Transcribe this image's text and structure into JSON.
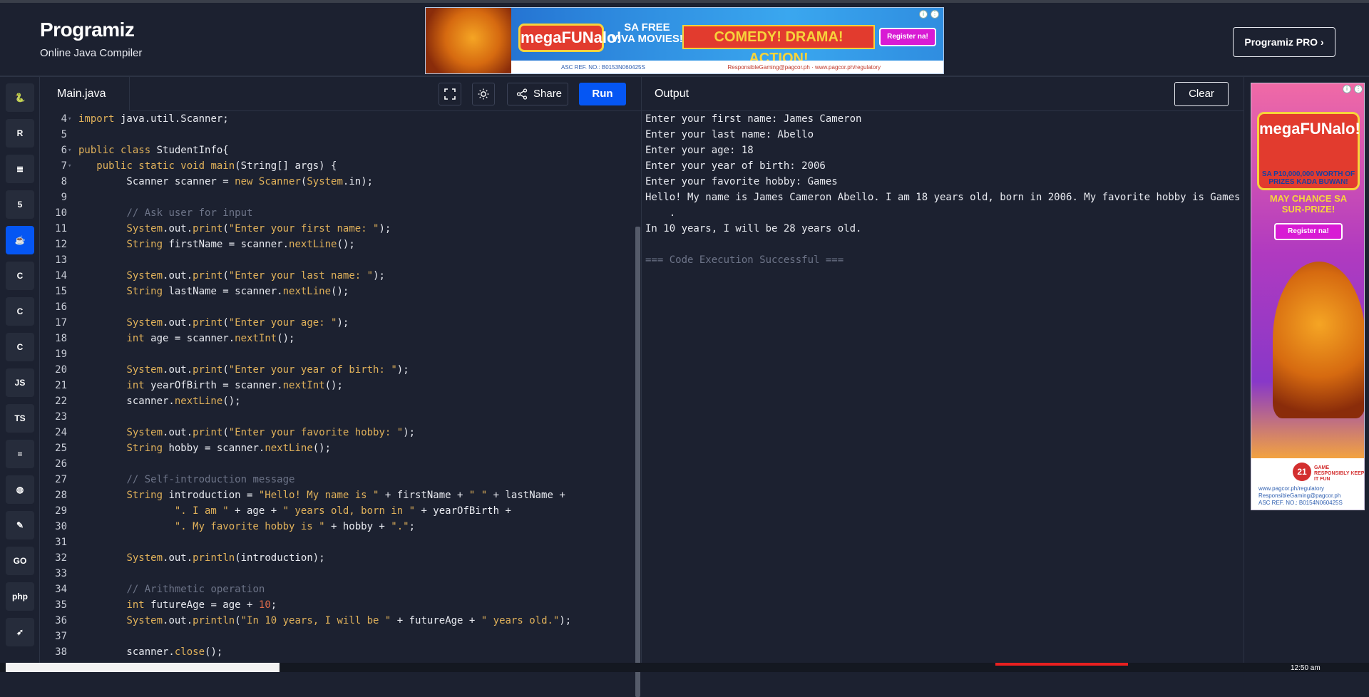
{
  "header": {
    "logo": "Programiz",
    "subtitle": "Online Java Compiler",
    "pro_button": "Programiz PRO ›"
  },
  "ad_top": {
    "mega": "megaFUNalo!",
    "free_line1": "SA FREE",
    "free_line2": "VIVA MOVIES!",
    "headline": "COMEDY! DRAMA! ACTION!",
    "register": "Register na!",
    "asc": "ASC REF. NO.: B0153N060425S",
    "responsible": "ResponsibleGaming@pagcor.ph · www.pagcor.ph/regulatory"
  },
  "sidebar": {
    "items": [
      {
        "name": "python",
        "icon": "python-icon",
        "label": "🐍"
      },
      {
        "name": "r",
        "icon": "r-icon",
        "label": "R"
      },
      {
        "name": "sql",
        "icon": "database-icon",
        "label": "≣"
      },
      {
        "name": "html",
        "icon": "html5-icon",
        "label": "5"
      },
      {
        "name": "java",
        "icon": "java-icon",
        "label": "☕"
      },
      {
        "name": "c",
        "icon": "c-icon",
        "label": "C"
      },
      {
        "name": "cpp",
        "icon": "cpp-icon",
        "label": "C"
      },
      {
        "name": "csharp",
        "icon": "csharp-icon",
        "label": "C"
      },
      {
        "name": "js",
        "icon": "js-icon",
        "label": "JS"
      },
      {
        "name": "ts",
        "icon": "ts-icon",
        "label": "TS"
      },
      {
        "name": "go",
        "icon": "stack-icon",
        "label": "≡"
      },
      {
        "name": "ruby",
        "icon": "ball-icon",
        "label": "◍"
      },
      {
        "name": "draw",
        "icon": "pen-icon",
        "label": "✎"
      },
      {
        "name": "golang",
        "icon": "go-icon",
        "label": "GO"
      },
      {
        "name": "php",
        "icon": "php-icon",
        "label": "php"
      },
      {
        "name": "swift",
        "icon": "swift-icon",
        "label": "➶"
      }
    ]
  },
  "editor": {
    "tab": "Main.java",
    "share": "Share",
    "run": "Run",
    "lines": [
      {
        "n": "4",
        "fold": "▾",
        "html": "<span class=\"kw\">import</span> java.util.Scanner;"
      },
      {
        "n": "5",
        "fold": "",
        "html": ""
      },
      {
        "n": "6",
        "fold": "▾",
        "html": "<span class=\"kw\">public class</span> StudentInfo{"
      },
      {
        "n": "7",
        "fold": "▾",
        "html": "   <span class=\"kw\">public static void</span> <span class=\"fn\">main</span>(String[] args) {"
      },
      {
        "n": "8",
        "fold": "",
        "html": "        Scanner scanner = <span class=\"kw\">new</span> <span class=\"fn\">Scanner</span>(<span class=\"ty\">System</span>.in);"
      },
      {
        "n": "9",
        "fold": "",
        "html": ""
      },
      {
        "n": "10",
        "fold": "",
        "html": "        <span class=\"cm\">// Ask user for input</span>"
      },
      {
        "n": "11",
        "fold": "",
        "html": "        <span class=\"ty\">System</span>.out.<span class=\"fn\">print</span>(<span class=\"st\">\"Enter your first name: \"</span>);"
      },
      {
        "n": "12",
        "fold": "",
        "html": "        <span class=\"ty\">String</span> firstName = scanner.<span class=\"fn\">nextLine</span>();"
      },
      {
        "n": "13",
        "fold": "",
        "html": ""
      },
      {
        "n": "14",
        "fold": "",
        "html": "        <span class=\"ty\">System</span>.out.<span class=\"fn\">print</span>(<span class=\"st\">\"Enter your last name: \"</span>);"
      },
      {
        "n": "15",
        "fold": "",
        "html": "        <span class=\"ty\">String</span> lastName = scanner.<span class=\"fn\">nextLine</span>();"
      },
      {
        "n": "16",
        "fold": "",
        "html": ""
      },
      {
        "n": "17",
        "fold": "",
        "html": "        <span class=\"ty\">System</span>.out.<span class=\"fn\">print</span>(<span class=\"st\">\"Enter your age: \"</span>);"
      },
      {
        "n": "18",
        "fold": "",
        "html": "        <span class=\"kw\">int</span> age = scanner.<span class=\"fn\">nextInt</span>();"
      },
      {
        "n": "19",
        "fold": "",
        "html": ""
      },
      {
        "n": "20",
        "fold": "",
        "html": "        <span class=\"ty\">System</span>.out.<span class=\"fn\">print</span>(<span class=\"st\">\"Enter your year of birth: \"</span>);"
      },
      {
        "n": "21",
        "fold": "",
        "html": "        <span class=\"kw\">int</span> yearOfBirth = scanner.<span class=\"fn\">nextInt</span>();"
      },
      {
        "n": "22",
        "fold": "",
        "html": "        scanner.<span class=\"fn\">nextLine</span>();"
      },
      {
        "n": "23",
        "fold": "",
        "html": ""
      },
      {
        "n": "24",
        "fold": "",
        "html": "        <span class=\"ty\">System</span>.out.<span class=\"fn\">print</span>(<span class=\"st\">\"Enter your favorite hobby: \"</span>);"
      },
      {
        "n": "25",
        "fold": "",
        "html": "        <span class=\"ty\">String</span> hobby = scanner.<span class=\"fn\">nextLine</span>();"
      },
      {
        "n": "26",
        "fold": "",
        "html": ""
      },
      {
        "n": "27",
        "fold": "",
        "html": "        <span class=\"cm\">// Self-introduction message</span>"
      },
      {
        "n": "28",
        "fold": "",
        "html": "        <span class=\"ty\">String</span> introduction = <span class=\"st\">\"Hello! My name is \"</span> + firstName + <span class=\"st\">\" \"</span> + lastName +"
      },
      {
        "n": "29",
        "fold": "",
        "html": "                <span class=\"st\">\". I am \"</span> + age + <span class=\"st\">\" years old, born in \"</span> + yearOfBirth +"
      },
      {
        "n": "30",
        "fold": "",
        "html": "                <span class=\"st\">\". My favorite hobby is \"</span> + hobby + <span class=\"st\">\".\"</span>;"
      },
      {
        "n": "31",
        "fold": "",
        "html": ""
      },
      {
        "n": "32",
        "fold": "",
        "html": "        <span class=\"ty\">System</span>.out.<span class=\"fn\">println</span>(introduction);"
      },
      {
        "n": "33",
        "fold": "",
        "html": ""
      },
      {
        "n": "34",
        "fold": "",
        "html": "        <span class=\"cm\">// Arithmetic operation</span>"
      },
      {
        "n": "35",
        "fold": "",
        "html": "        <span class=\"kw\">int</span> futureAge = age + <span class=\"num\">10</span>;"
      },
      {
        "n": "36",
        "fold": "",
        "html": "        <span class=\"ty\">System</span>.out.<span class=\"fn\">println</span>(<span class=\"st\">\"In 10 years, I will be \"</span> + futureAge + <span class=\"st\">\" years old.\"</span>);"
      },
      {
        "n": "37",
        "fold": "",
        "html": ""
      },
      {
        "n": "38",
        "fold": "",
        "html": "        scanner.<span class=\"fn\">close</span>();"
      }
    ]
  },
  "output": {
    "title": "Output",
    "clear": "Clear",
    "lines": [
      "Enter your first name: James Cameron",
      "Enter your last name: Abello",
      "Enter your age: 18",
      "Enter your year of birth: 2006",
      "Enter your favorite hobby: Games",
      "Hello! My name is James Cameron Abello. I am 18 years old, born in 2006. My favorite hobby is Games",
      "    .",
      "In 10 years, I will be 28 years old.",
      ""
    ],
    "status": "=== Code Execution Successful ==="
  },
  "ad_side": {
    "mega": "megaFUNalo!",
    "prize": "SA P10,000,000 WORTH OF PRIZES KADA BUWAN!",
    "chance": "MAY CHANCE SA SUR-PRIZE!",
    "register": "Register na!",
    "badge": "21",
    "responsible": "GAME RESPONSIBLY KEEP IT FUN",
    "link1": "www.pagcor.ph/regulatory",
    "link2": "ResponsibleGaming@pagcor.ph",
    "asc": "ASC REF. NO.: B0154N060425S"
  },
  "taskbar": {
    "time": "12:50 am"
  }
}
